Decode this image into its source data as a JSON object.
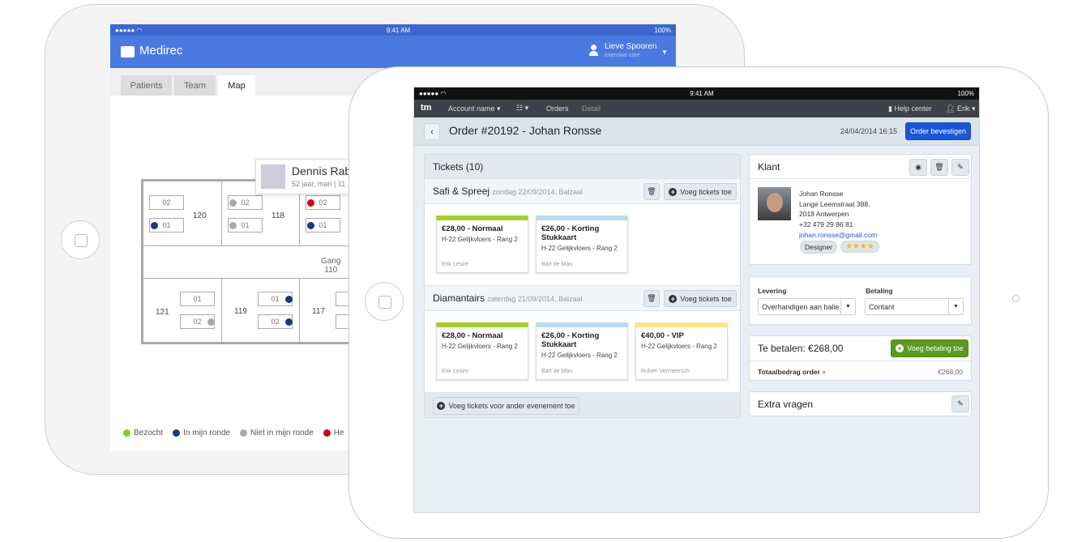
{
  "back": {
    "status": {
      "time": "9:41 AM",
      "battery": "100%"
    },
    "app_title": "Medirec",
    "user": {
      "name": "Lieve Spooren",
      "role": "Intensive care"
    },
    "tabs": [
      {
        "label": "Patients"
      },
      {
        "label": "Team"
      },
      {
        "label": "Map",
        "active": true
      }
    ],
    "tooltip": {
      "name": "Dennis Rab",
      "info": "52 jaar, man",
      "info2": "11"
    },
    "corridor": {
      "name": "Gang",
      "number": "110"
    },
    "rooms": [
      "120",
      "118",
      "121",
      "119",
      "117"
    ],
    "beds": {
      "a": "01",
      "b": "02"
    },
    "legend": [
      {
        "label": "Bezocht",
        "color": "#7ed321"
      },
      {
        "label": "In mijn ronde",
        "color": "#1c3a7a"
      },
      {
        "label": "Niet in mijn ronde",
        "color": "#aaaaaa"
      },
      {
        "label": "He",
        "color": "#d0021b"
      }
    ],
    "colors": {
      "header": "#4a7ae0"
    }
  },
  "front": {
    "status": {
      "time": "9:41 AM",
      "battery": "100%"
    },
    "nav": {
      "logo": "tm",
      "account": "Account name",
      "orders": "Orders",
      "detail": "Detail",
      "help": "Help center",
      "user": "Erik"
    },
    "header": {
      "title": "Order #20192 - Johan Ronsse",
      "date": "24/04/2014 16:15",
      "confirm": "Order bevestigen"
    },
    "tickets": {
      "title": "Tickets (10)",
      "add_label": "Voeg tickets toe",
      "events": [
        {
          "name": "Safi & Spreej",
          "date": "zondag 22/09/2014, Balzaal",
          "cards": [
            {
              "title": "€28,00 - Normaal",
              "seat": "H-22 Gelijkvloers - Rang 2",
              "person": "Erik Lesire",
              "color": "#a5cf2b"
            },
            {
              "title": "€26,00 - Korting Stukkaart",
              "seat": "H-22 Gelijkvloers - Rang 2",
              "person": "Bart de Man",
              "color": "#b9dcef"
            }
          ]
        },
        {
          "name": "Diamantairs",
          "date": "zaterdag 21/09/2014, Balzaal",
          "cards": [
            {
              "title": "€28,00 - Normaal",
              "seat": "H-22 Gelijkvloers - Rang 2",
              "person": "Erik Lesire",
              "color": "#a5cf2b"
            },
            {
              "title": "€26,00 - Korting Stukkaart",
              "seat": "H-22 Gelijkvloers - Rang 2",
              "person": "Bart de Man",
              "color": "#b9dcef"
            },
            {
              "title": "€40,00 - VIP",
              "seat": "H-22 Gelijkvloers - Rang 2",
              "person": "Ruben Vermeersch",
              "color": "#fde68a"
            }
          ]
        }
      ],
      "add_other": "Voeg tickets voor ander evenement toe"
    },
    "klant": {
      "title": "Klant",
      "name": "Johan Ronsse",
      "street": "Lange Leemstraat 388,",
      "city": "2018 Antwerpen",
      "phone": "+32 479 29 86 81",
      "email": "johan.ronsse@gmail.com",
      "tag": "Designer",
      "rating": 4,
      "stars": "★★★★"
    },
    "levering": {
      "label": "Levering",
      "value": "Overhandigen aan balie"
    },
    "betaling": {
      "label": "Betaling",
      "value": "Contant"
    },
    "payment": {
      "title": "Te betalen: €268,00",
      "add": "Voeg betaling toe",
      "total_label": "Totaalbedrag order",
      "total": "€268,00"
    },
    "extra": {
      "title": "Extra vragen"
    },
    "colors": {
      "primary": "#1a56d6",
      "success": "#5a9a1e",
      "nav": "#3d4148"
    }
  }
}
